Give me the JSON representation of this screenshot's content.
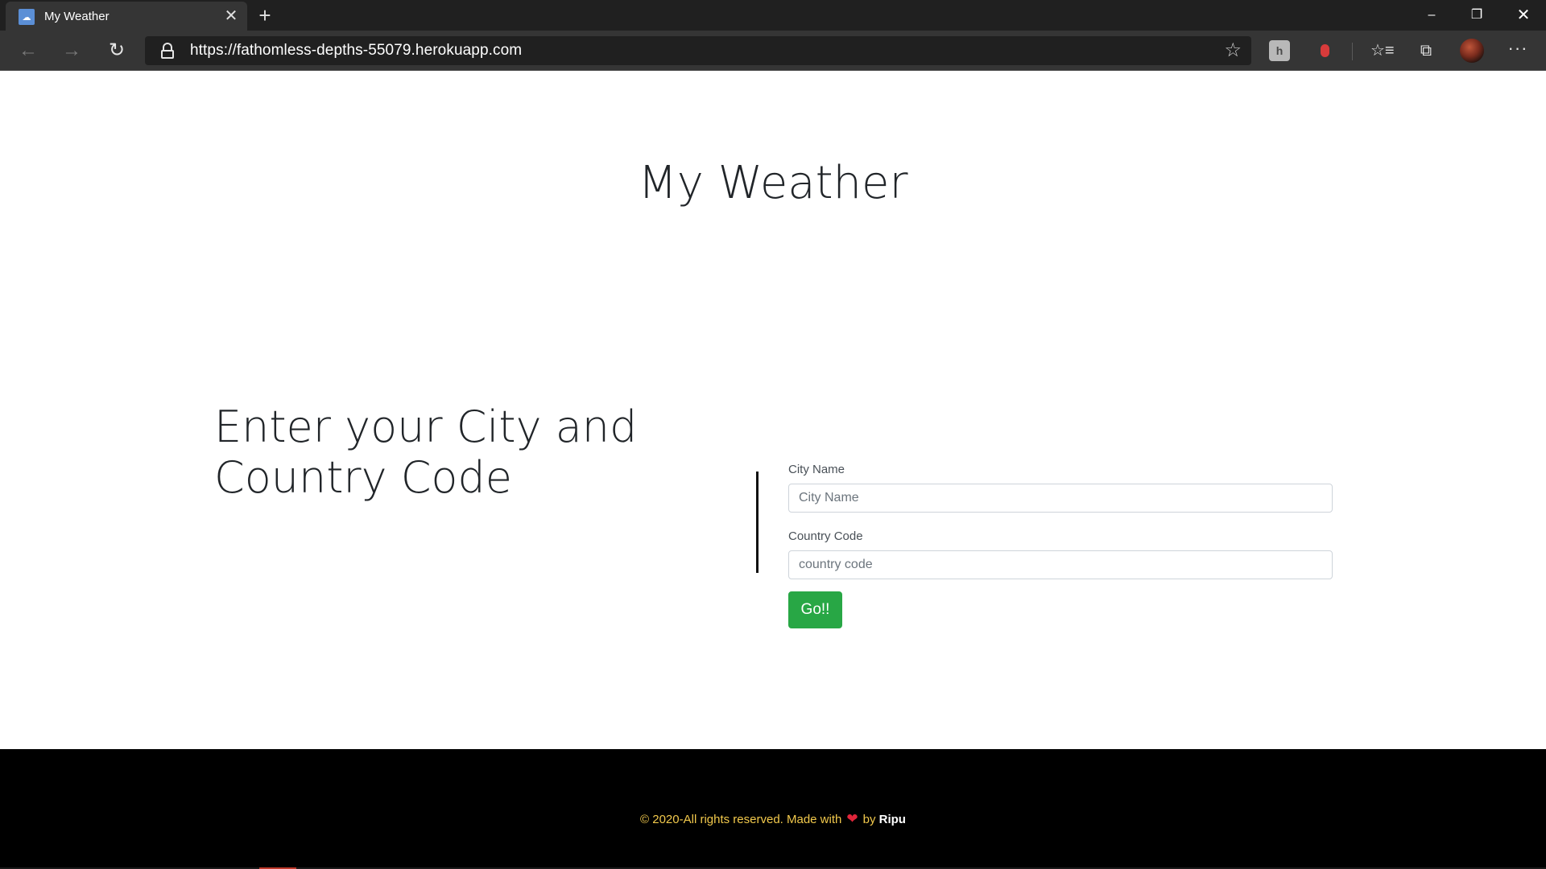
{
  "browser": {
    "tab": {
      "title": "My Weather",
      "close_glyph": "✕",
      "favicon_icon": "weather-favicon-icon"
    },
    "new_tab_glyph": "+",
    "window_controls": {
      "minimize": "–",
      "maximize": "❐",
      "close": "✕"
    },
    "nav": {
      "back": "←",
      "forward": "→",
      "refresh": "↻"
    },
    "address": {
      "url": "https://fathomless-depths-55079.herokuapp.com",
      "star_glyph": "☆"
    },
    "extensions": {
      "ext1": "h",
      "favorites": "☆≡",
      "collections": "⧉"
    },
    "more_glyph": "···"
  },
  "page": {
    "title": "My Weather",
    "lead": "Enter your City and Country Code",
    "form": {
      "city": {
        "label": "City Name",
        "placeholder": "City Name",
        "value": ""
      },
      "country": {
        "label": "Country Code",
        "placeholder": "country code",
        "value": ""
      },
      "submit_label": "Go!!"
    }
  },
  "footer": {
    "text_before": "© 2020-All rights reserved. Made with",
    "heart": "❤",
    "by": "by",
    "author": "Ripu"
  },
  "colors": {
    "button": "#28a745",
    "footer_bg": "#000000",
    "footer_text": "#f2c94c",
    "heart": "#e0253a"
  }
}
